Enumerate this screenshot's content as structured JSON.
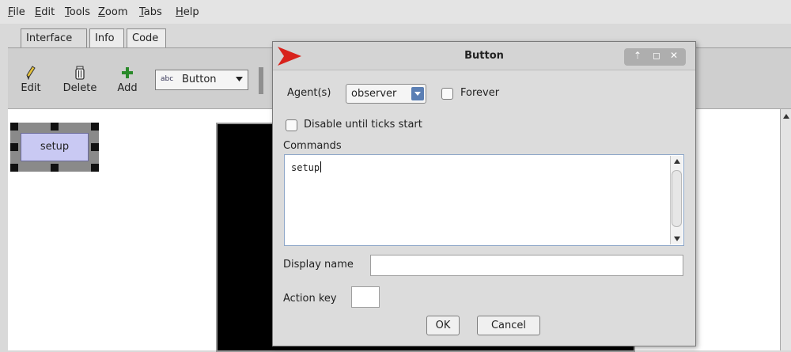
{
  "menubar": {
    "items": [
      "File",
      "Edit",
      "Tools",
      "Zoom",
      "Tabs",
      "Help"
    ]
  },
  "tabs": [
    {
      "label": "Interface",
      "active": true
    },
    {
      "label": "Info",
      "active": false
    },
    {
      "label": "Code",
      "active": false
    }
  ],
  "toolbar": {
    "edit_label": "Edit",
    "delete_label": "Delete",
    "add_label": "Add",
    "widget_type_badge": "abc",
    "widget_type_selected": "Button"
  },
  "interface": {
    "setup_button_label": "setup"
  },
  "dialog": {
    "title": "Button",
    "agents_label": "Agent(s)",
    "agents_selected": "observer",
    "forever_label": "Forever",
    "disable_label": "Disable until ticks start",
    "commands_label": "Commands",
    "commands_value": "setup",
    "display_name_label": "Display name",
    "display_name_value": "",
    "action_key_label": "Action key",
    "action_key_value": "",
    "ok_label": "OK",
    "cancel_label": "Cancel"
  },
  "colors": {
    "logo_red": "#d8231c",
    "add_green": "#2a8a2a",
    "setup_button_fill": "#c9c9f3",
    "combo_blue": "#5b7fb4"
  },
  "icons": {
    "edit": "pencil-icon",
    "delete": "trash-icon",
    "add": "plus-icon",
    "dialog_logo": "netlogo-logo-icon"
  }
}
